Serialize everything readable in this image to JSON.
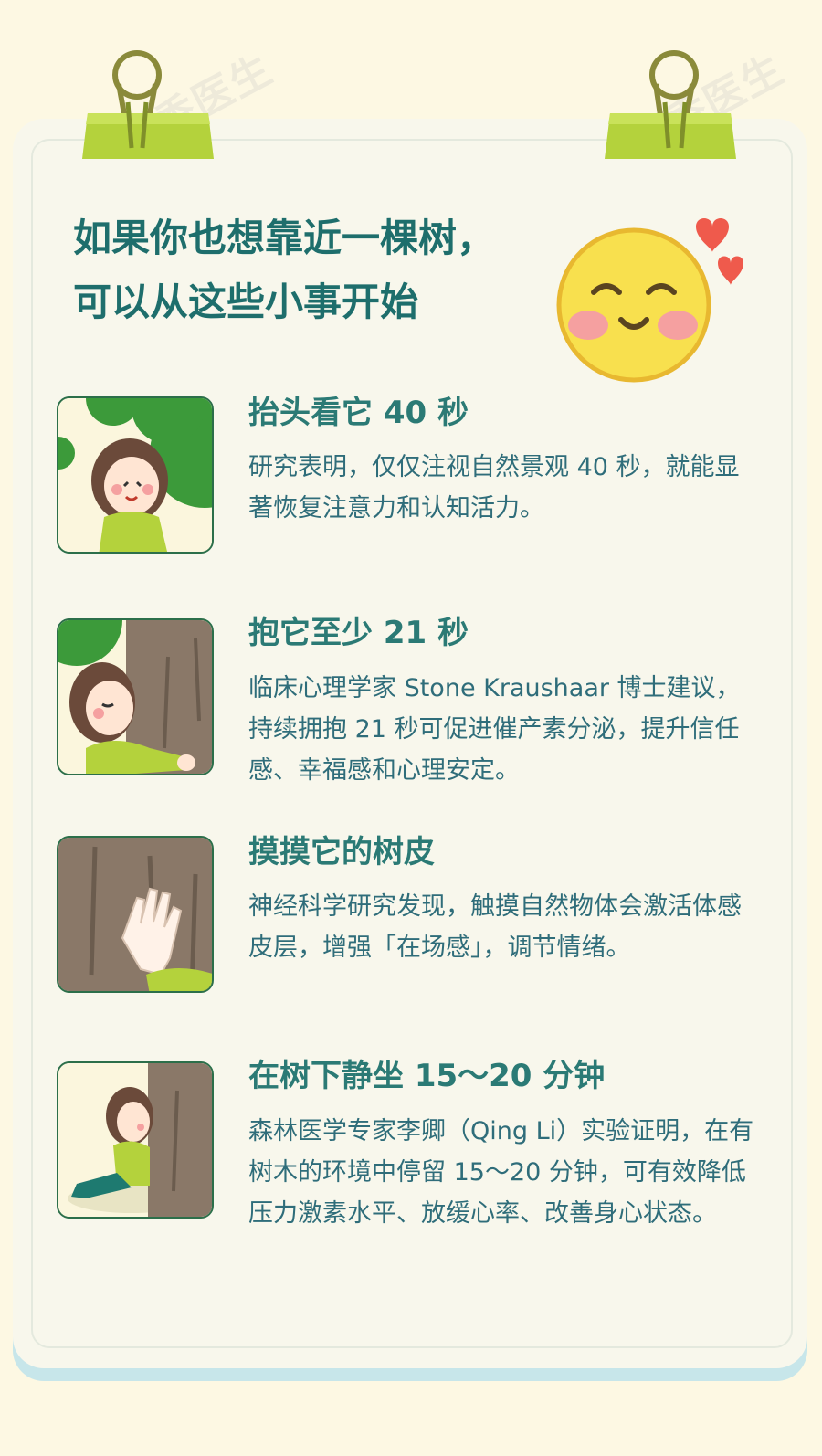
{
  "watermark": "丁香医生",
  "heading": {
    "line1": "如果你也想靠近一棵树，",
    "line2": "可以从这些小事开始"
  },
  "items": [
    {
      "title": "抬头看它 40 秒",
      "desc": "研究表明，仅仅注视自然景观 40 秒，就能显著恢复注意力和认知活力。"
    },
    {
      "title": "抱它至少 21 秒",
      "desc": "临床心理学家 Stone Kraushaar 博士建议，持续拥抱 21 秒可促进催产素分泌，提升信任感、幸福感和心理安定。"
    },
    {
      "title": "摸摸它的树皮",
      "desc": "神经科学研究发现，触摸自然物体会激活体感皮层，增强「在场感」，调节情绪。"
    },
    {
      "title": "在树下静坐 15～20 分钟",
      "desc": "森林医学专家李卿（Qing Li）实验证明，在有树木的环境中停留 15～20 分钟，可有效降低压力激素水平、放缓心率、改善身心状态。"
    }
  ],
  "colors": {
    "background": "#fdf8e3",
    "card": "#f8f7ec",
    "heading": "#1e6e6c",
    "item_title": "#2b7a75",
    "item_text": "#2f6d7a",
    "clip": "#b4d23c",
    "shadow_band": "#c7e6ea"
  },
  "icons": [
    "binder-clip-icon",
    "smiling-face-icon",
    "heart-icon"
  ]
}
